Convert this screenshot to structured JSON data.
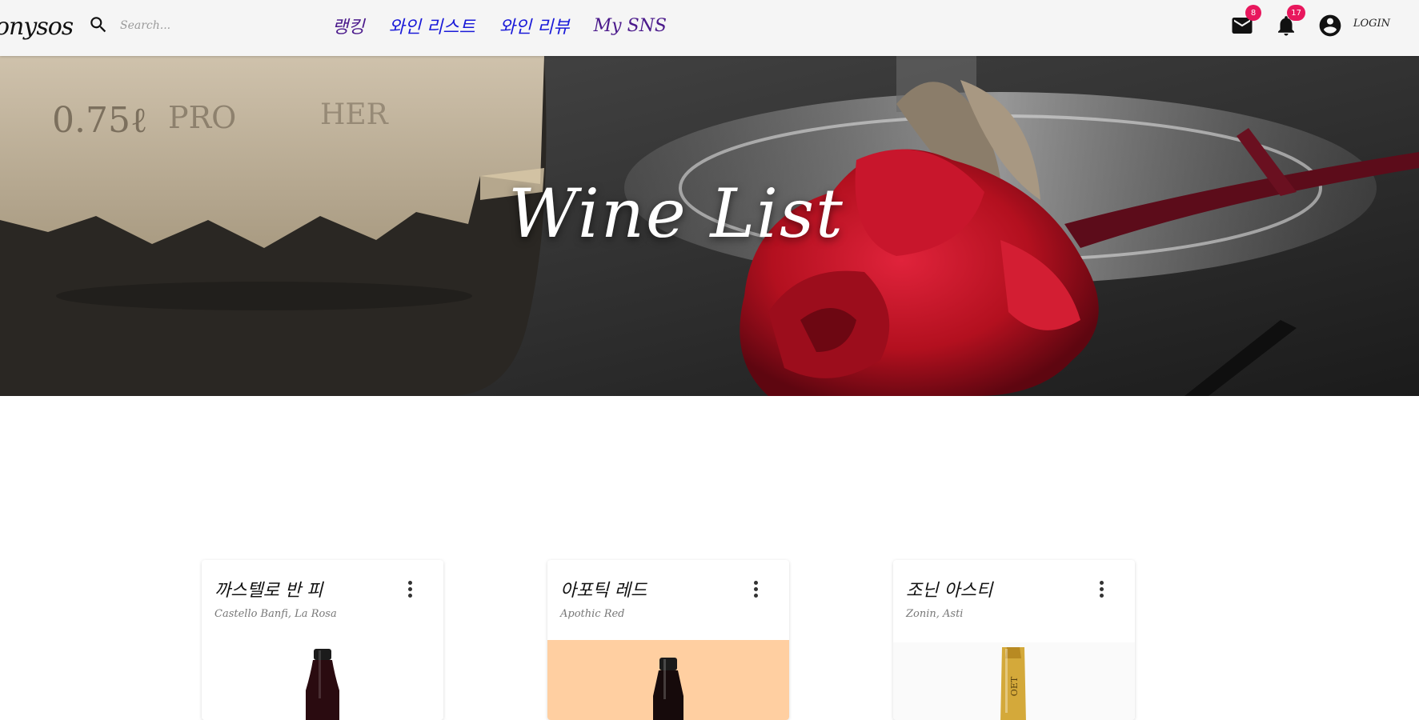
{
  "header": {
    "logo": "onysos",
    "search": {
      "placeholder": "Search..."
    },
    "nav": [
      {
        "label": "랭킹",
        "color": "#4b1a8c"
      },
      {
        "label": "와인 리스트",
        "color": "#1a1ad8"
      },
      {
        "label": "와인 리뷰",
        "color": "#1a1ad8"
      },
      {
        "label": "My SNS",
        "color": "#4b1a8c"
      }
    ],
    "mail": {
      "icon": "mail-icon",
      "badge": "8"
    },
    "notifications": {
      "icon": "bell-icon",
      "badge": "17"
    },
    "account": {
      "icon": "account-circle-icon"
    },
    "login_label": "LOGIN"
  },
  "hero": {
    "title": "Wine List"
  },
  "cards": [
    {
      "title": "까스텔로 반 피",
      "subtitle": "Castello Banfi, La Rosa",
      "media_bg": "#ffffff"
    },
    {
      "title": "아포틱 레드",
      "subtitle": "Apothic Red",
      "media_bg": "#ffcfa1"
    },
    {
      "title": "조닌 아스티",
      "subtitle": "Zonin, Asti",
      "media_bg": "#fafafa"
    }
  ]
}
